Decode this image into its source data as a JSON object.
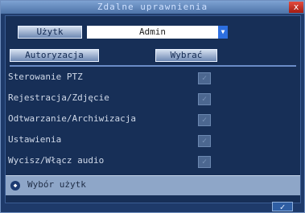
{
  "window": {
    "title": "Zdalne uprawnienia",
    "close_label": "x"
  },
  "user": {
    "button_label": "Użytk",
    "selected_value": "Admin",
    "dropdown_arrow": "▼"
  },
  "actions": {
    "authorization_label": "Autoryzacja",
    "select_label": "Wybrać"
  },
  "permissions": [
    {
      "label": "Sterowanie PTZ",
      "checked": true
    },
    {
      "label": "Rejestracja/Zdjęcie",
      "checked": true
    },
    {
      "label": "Odtwarzanie/Archiwizacja",
      "checked": true
    },
    {
      "label": "Ustawienia",
      "checked": true
    },
    {
      "label": "Wycisz/Włącz audio",
      "checked": true
    }
  ],
  "hint": {
    "text": "Wybór użytk"
  },
  "footer": {
    "ok_label": "✓"
  },
  "colors": {
    "window_bg": "#1e3a6a",
    "title_bar": "#5c82b8",
    "hint_bar": "#8ea6c8",
    "close_button": "#c93a2f"
  }
}
